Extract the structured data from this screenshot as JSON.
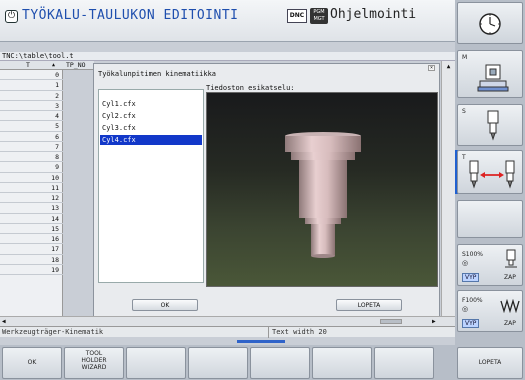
{
  "header": {
    "mode_title": "TYÖKALU-TAULUKON EDITOINTI",
    "dnc_badge": "DNC",
    "pgm_badge_line1": "PGM",
    "pgm_badge_line2": "MGT",
    "right_mode": "Ohjelmointi"
  },
  "path": "TNC:\\table\\tool.t",
  "table": {
    "col_t": "T",
    "col_tp": "TP_NO",
    "rows": [
      "0",
      "1",
      "2",
      "3",
      "4",
      "5",
      "6",
      "7",
      "8",
      "9",
      "10",
      "11",
      "12",
      "13",
      "14",
      "15",
      "16",
      "17",
      "18",
      "19"
    ]
  },
  "dialog": {
    "title": "Työkalunpitimen kinematiikka",
    "preview_label": "Tiedoston esikatselu:",
    "files": [
      "Cyl1.cfx",
      "Cyl2.cfx",
      "Cyl3.cfx",
      "Cyl4.cfx"
    ],
    "selected_file": "Cyl4.cfx",
    "ok": "OK",
    "cancel": "LOPETA"
  },
  "status": {
    "left": "Werkzeugträger-Kinematik",
    "right": "Text width 20"
  },
  "right_softkeys": {
    "m_label": "M",
    "s_label": "S",
    "t_label": "T",
    "s100": "S100%",
    "vyp1": "VYP",
    "zap1": "ZAP",
    "f100": "F100%",
    "vyp2": "VYP",
    "zap2": "ZAP"
  },
  "bottom_softkeys": {
    "ok": "OK",
    "tool_holder_line1": "TOOL",
    "tool_holder_line2": "HOLDER",
    "tool_holder_line3": "WIZARD",
    "lopeta": "LOPETA"
  },
  "colors": {
    "accent_blue": "#1238c9",
    "title_blue": "#1f4fae"
  }
}
